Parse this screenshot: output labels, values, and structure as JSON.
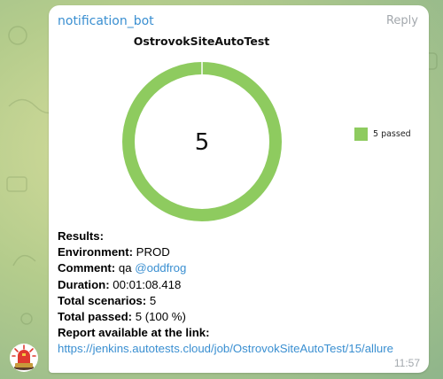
{
  "message": {
    "sender": "notification_bot",
    "reply_label": "Reply",
    "time": "11:57"
  },
  "chart_data": {
    "type": "pie",
    "title": "OstrovokSiteAutoTest",
    "center_label": "5",
    "series": [
      {
        "name": "5 passed",
        "value": 5,
        "color": "#8ecb5f"
      }
    ]
  },
  "report": {
    "results_label": "Results:",
    "environment_label": "Environment:",
    "environment_value": "PROD",
    "comment_label": "Comment:",
    "comment_text": "qa",
    "comment_mention": "@oddfrog",
    "duration_label": "Duration:",
    "duration_value": "00:01:08.418",
    "total_scenarios_label": "Total scenarios:",
    "total_scenarios_value": "5",
    "total_passed_label": "Total passed:",
    "total_passed_value": "5 (100 %)",
    "report_link_label": "Report available at the link:",
    "report_link": "https://jenkins.autotests.cloud/job/OstrovokSiteAutoTest/15/allure"
  }
}
